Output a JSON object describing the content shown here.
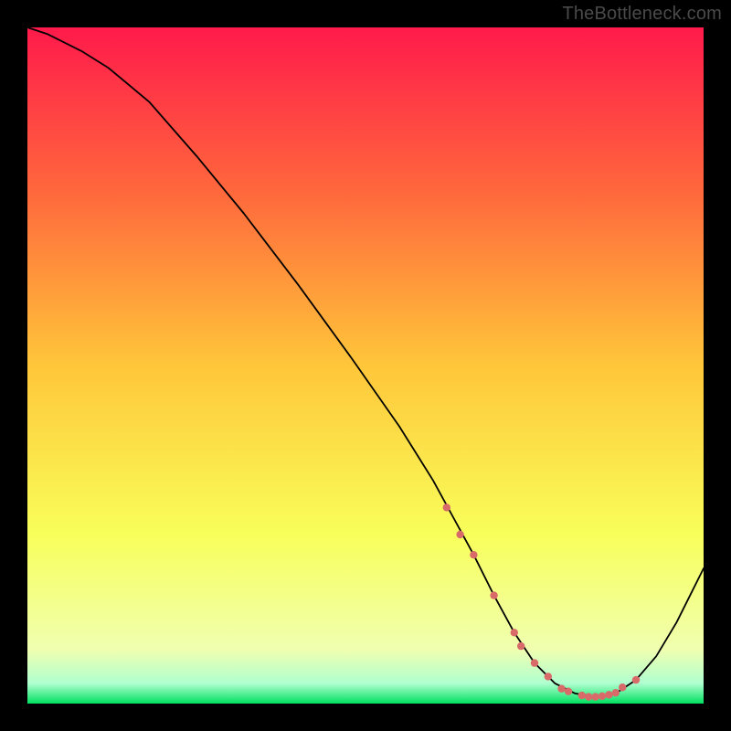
{
  "watermark": "TheBottleneck.com",
  "chart_data": {
    "type": "line",
    "title": "",
    "xlabel": "",
    "ylabel": "",
    "xlim": [
      0,
      100
    ],
    "ylim": [
      0,
      100
    ],
    "grid": false,
    "legend": false,
    "gradient_stops": [
      {
        "offset": 0,
        "color": "#ff1a4b"
      },
      {
        "offset": 25,
        "color": "#ff6a3c"
      },
      {
        "offset": 50,
        "color": "#ffc63a"
      },
      {
        "offset": 75,
        "color": "#f8ff5a"
      },
      {
        "offset": 92,
        "color": "#f0ffb0"
      },
      {
        "offset": 97,
        "color": "#b0ffd0"
      },
      {
        "offset": 100,
        "color": "#00e060"
      }
    ],
    "series": [
      {
        "name": "curve",
        "stroke": "#000000",
        "stroke_width": 1.8,
        "x": [
          0,
          3,
          5,
          8,
          12,
          18,
          25,
          32,
          40,
          48,
          55,
          60,
          63,
          66,
          69,
          72,
          75,
          78,
          81,
          84,
          87,
          90,
          93,
          96,
          100
        ],
        "y": [
          100,
          99,
          98,
          96.5,
          94,
          89,
          81,
          72.5,
          62,
          51,
          41,
          33,
          27.5,
          22,
          16,
          10.5,
          6,
          3,
          1.5,
          1,
          1.5,
          3.5,
          7,
          12,
          20
        ]
      }
    ],
    "markers": {
      "name": "highlight-dots",
      "color": "#d86a6a",
      "radius": 4.2,
      "x": [
        62,
        64,
        66,
        69,
        72,
        73,
        75,
        77,
        79,
        80,
        82,
        83,
        84,
        85,
        86,
        87,
        88,
        90
      ],
      "y": [
        29,
        25,
        22,
        16,
        10.5,
        8.5,
        6,
        4,
        2.2,
        1.8,
        1.2,
        1,
        1,
        1.1,
        1.3,
        1.6,
        2.4,
        3.5
      ]
    }
  }
}
